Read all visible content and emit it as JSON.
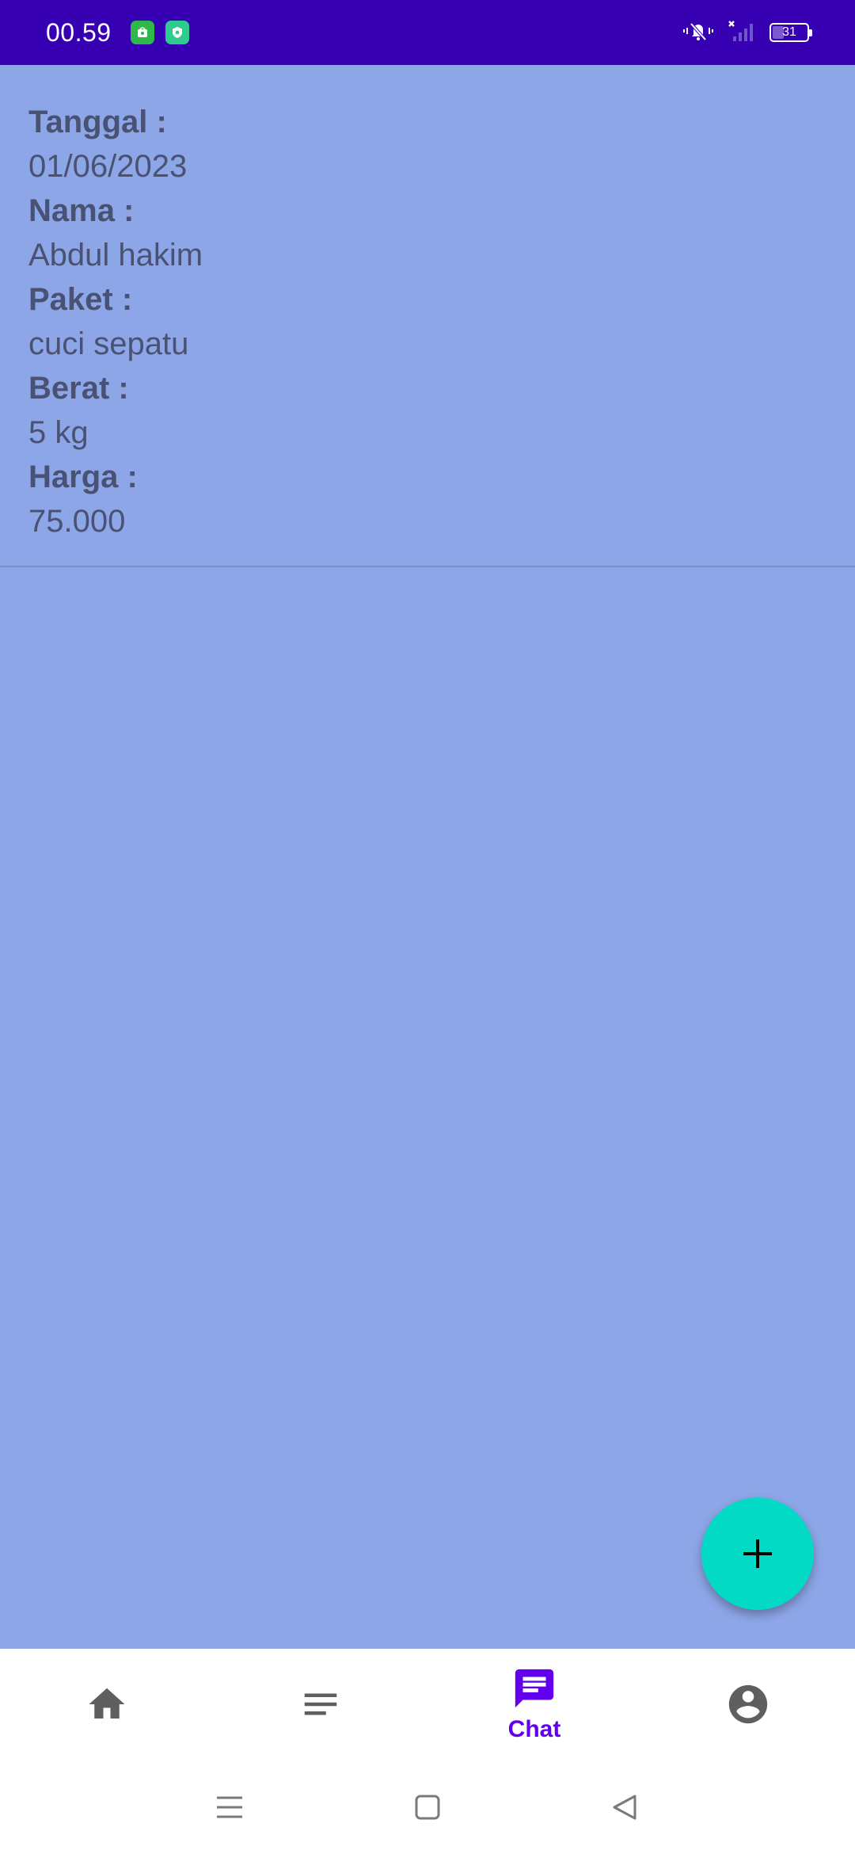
{
  "status_bar": {
    "time": "00.59",
    "battery_level": "31",
    "icons": [
      "app-store-icon",
      "shield-icon",
      "vibrate-silent-icon",
      "no-signal-icon",
      "battery-icon"
    ]
  },
  "order": {
    "tanggal_label": "Tanggal :",
    "tanggal_value": "01/06/2023",
    "nama_label": "Nama :",
    "nama_value": "Abdul hakim",
    "paket_label": "Paket :",
    "paket_value": "cuci sepatu",
    "berat_label": "Berat :",
    "berat_value": "5 kg",
    "harga_label": "Harga :",
    "harga_value": "75.000"
  },
  "fab": {
    "icon": "plus-icon"
  },
  "bottom_nav": {
    "items": [
      {
        "icon": "home-icon",
        "label": ""
      },
      {
        "icon": "list-icon",
        "label": ""
      },
      {
        "icon": "chat-icon",
        "label": "Chat",
        "active": true
      },
      {
        "icon": "account-icon",
        "label": ""
      }
    ],
    "active_color": "#6200EE",
    "inactive_color": "#5F5F5F"
  },
  "colors": {
    "status_bar": "#3700B3",
    "background": "#8DA6E8",
    "fab": "#03DAC5",
    "text": "#4A5273"
  }
}
